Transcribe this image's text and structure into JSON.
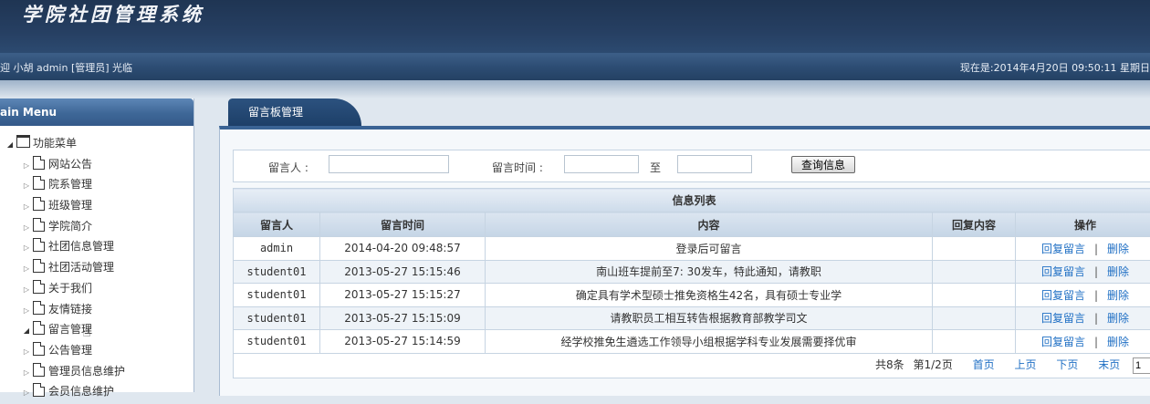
{
  "header": {
    "app_title": "学院社团管理系统"
  },
  "welcome_bar": {
    "welcome_text": "迎 小胡  admin [管理员] 光临",
    "clock_text": "现在是:2014年4月20日  09:50:11 星期日"
  },
  "sidebar": {
    "title": "ain Menu",
    "root_label": "功能菜单",
    "items": [
      {
        "label": "网站公告"
      },
      {
        "label": "院系管理"
      },
      {
        "label": "班级管理"
      },
      {
        "label": "学院简介"
      },
      {
        "label": "社团信息管理"
      },
      {
        "label": "社团活动管理"
      },
      {
        "label": "关于我们"
      },
      {
        "label": "友情链接"
      },
      {
        "label": "留言管理"
      },
      {
        "label": "公告管理"
      },
      {
        "label": "管理员信息维护"
      },
      {
        "label": "会员信息维护"
      }
    ]
  },
  "tab": {
    "label": "留言板管理"
  },
  "search": {
    "author_label": "留言人  :",
    "author_value": "",
    "time_label": "留言时间  :",
    "time_from": "",
    "to_label": "至",
    "time_to": "",
    "query_button": "查询信息"
  },
  "table": {
    "caption": "信息列表",
    "headers": {
      "author": "留言人",
      "time": "留言时间",
      "content": "内容",
      "reply": "回复内容",
      "ops": "操作"
    },
    "rows": [
      {
        "author": "admin",
        "time": "2014-04-20 09:48:57",
        "content": "登录后可留言",
        "reply": ""
      },
      {
        "author": "student01",
        "time": "2013-05-27 15:15:46",
        "content": "南山班车提前至7: 30发车，特此通知，请教职",
        "reply": ""
      },
      {
        "author": "student01",
        "time": "2013-05-27 15:15:27",
        "content": "确定具有学术型硕士推免资格生42名，具有硕士专业学",
        "reply": ""
      },
      {
        "author": "student01",
        "time": "2013-05-27 15:15:09",
        "content": "请教职员工相互转告根据教育部教学司文",
        "reply": ""
      },
      {
        "author": "student01",
        "time": "2013-05-27 15:14:59",
        "content": "经学校推免生遴选工作领导小组根据学科专业发展需要择优审",
        "reply": ""
      }
    ],
    "reply_link": "回复留言",
    "delete_link": "删除",
    "separator": "|"
  },
  "pager": {
    "total": "共8条",
    "page_info": "第1/2页",
    "first": "首页",
    "prev": "上页",
    "next": "下页",
    "last": "末页",
    "page_value": "1"
  }
}
